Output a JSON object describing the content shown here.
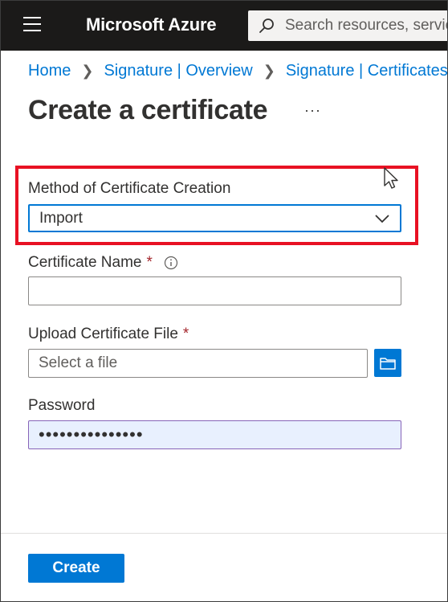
{
  "topbar": {
    "brand": "Microsoft Azure",
    "search_placeholder": "Search resources, services, and docs (G+/)"
  },
  "breadcrumb": [
    {
      "label": "Home"
    },
    {
      "label": "Signature | Overview"
    },
    {
      "label": "Signature | Certificates"
    }
  ],
  "page": {
    "title": "Create a certificate",
    "more_label": "···"
  },
  "form": {
    "method": {
      "label": "Method of Certificate Creation",
      "value": "Import"
    },
    "cert_name": {
      "label": "Certificate Name",
      "required_mark": "*",
      "value": ""
    },
    "upload": {
      "label": "Upload Certificate File",
      "required_mark": "*",
      "placeholder": "Select a file"
    },
    "password": {
      "label": "Password",
      "value": "•••••••••••••••"
    }
  },
  "footer": {
    "create_label": "Create"
  },
  "colors": {
    "accent": "#0078d4",
    "highlight": "#e81123",
    "required": "#a4262c",
    "topbar": "#1b1a19"
  },
  "icons": [
    "hamburger-icon",
    "search-icon",
    "more-icon",
    "info-icon",
    "chevron-down-icon",
    "folder-icon",
    "mouse-cursor-icon"
  ]
}
